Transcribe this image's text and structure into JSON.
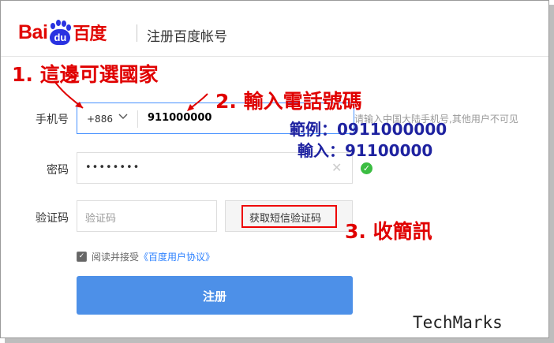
{
  "header": {
    "logo_text_left": "Bai",
    "logo_text_paw": "du",
    "logo_text_cn": "百度",
    "title": "注册百度帐号"
  },
  "form": {
    "phone_label": "手机号",
    "country_code": "+886",
    "phone_value": "911000000",
    "phone_hint": "请输入中国大陆手机号,其他用户不可见",
    "password_label": "密码",
    "password_value": "••••••••",
    "code_label": "验证码",
    "code_placeholder": "验证码",
    "sms_button": "获取短信验证码",
    "agree_text": "阅读并接受",
    "agree_link": "《百度用户协议》",
    "submit": "注册"
  },
  "annotations": {
    "step1": "1. 這邊可選國家",
    "step2": "2. 輸入電話號碼",
    "example": "範例：0911000000",
    "input": "輸入：91100000",
    "step3": "3. 收簡訊",
    "watermark": "TechMarks"
  },
  "colors": {
    "brand_red": "#e10602",
    "brand_blue": "#2932e1",
    "submit_bg": "#4d90e8",
    "annotation_red": "#e00000",
    "annotation_blue": "#1e22a0",
    "success_green": "#3bbd42"
  },
  "icons": {
    "country_dropdown": "chevron-down-icon",
    "clear": "close-icon",
    "password_ok": "check-circle-icon",
    "agree_checkbox": "checkbox-checked-icon"
  }
}
